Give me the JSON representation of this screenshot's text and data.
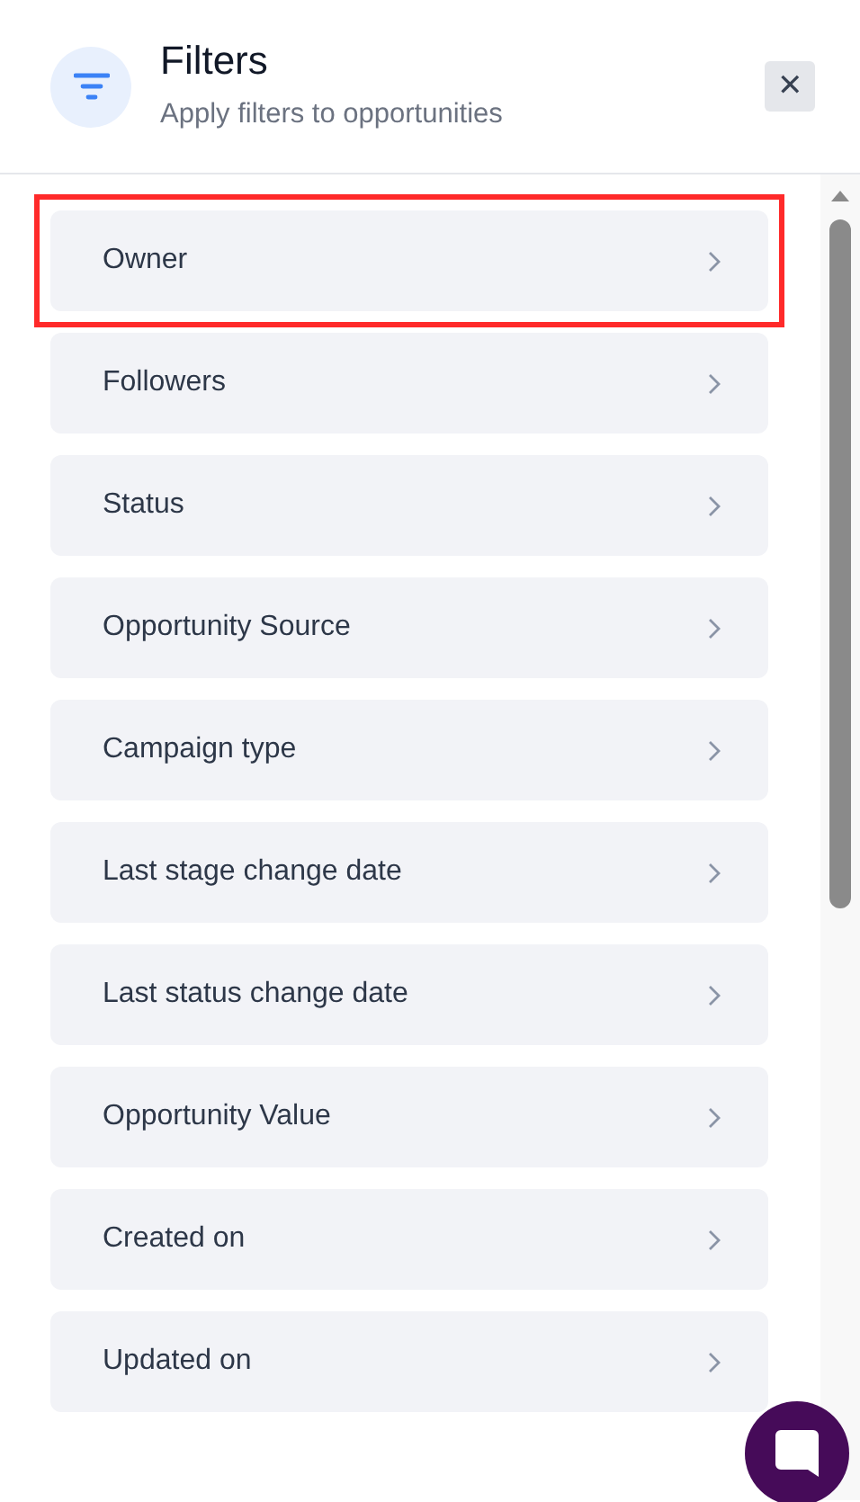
{
  "header": {
    "title": "Filters",
    "subtitle": "Apply filters to opportunities",
    "close_label": "✕"
  },
  "filters": [
    {
      "label": "Owner",
      "highlighted": true
    },
    {
      "label": "Followers",
      "highlighted": false
    },
    {
      "label": "Status",
      "highlighted": false
    },
    {
      "label": "Opportunity Source",
      "highlighted": false
    },
    {
      "label": "Campaign type",
      "highlighted": false
    },
    {
      "label": "Last stage change date",
      "highlighted": false
    },
    {
      "label": "Last status change date",
      "highlighted": false
    },
    {
      "label": "Opportunity Value",
      "highlighted": false
    },
    {
      "label": "Created on",
      "highlighted": false
    },
    {
      "label": "Updated on",
      "highlighted": false
    }
  ]
}
